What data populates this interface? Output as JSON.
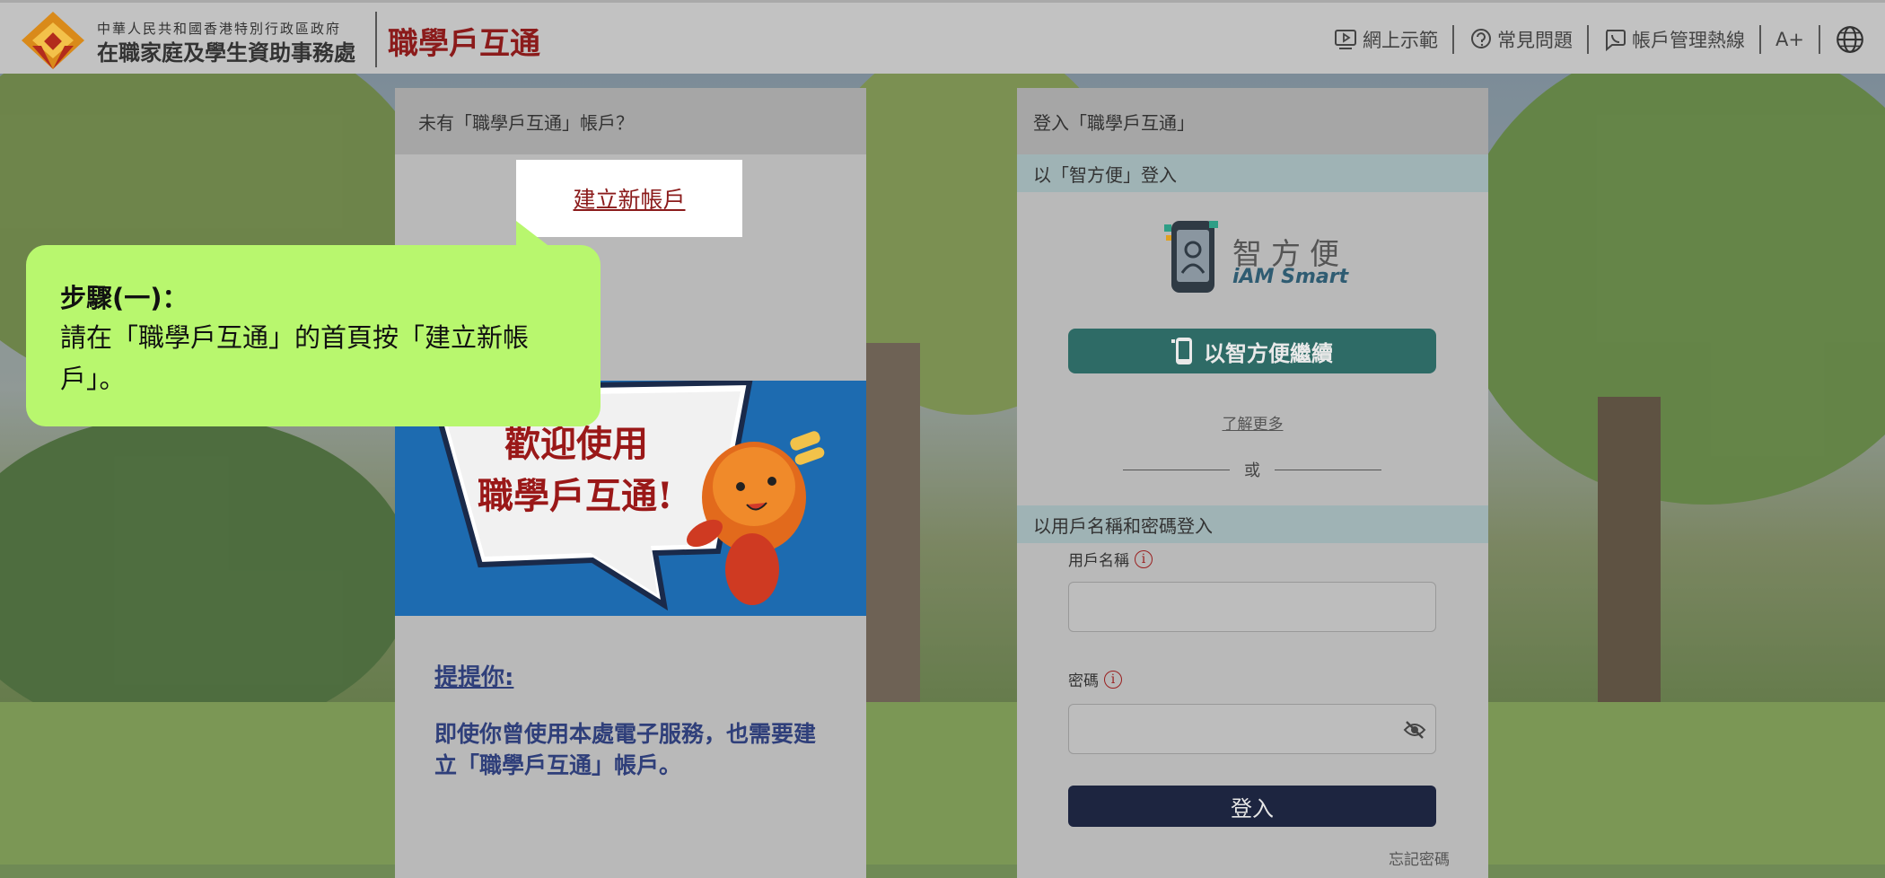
{
  "header": {
    "gov_line1": "中華人民共和國香港特別行政區政府",
    "gov_line2": "在職家庭及學生資助事務處",
    "brand": "職學戶互通",
    "nav": [
      {
        "label": "網上示範",
        "icon": "play-screen-icon"
      },
      {
        "label": "常見問題",
        "icon": "question-bubble-icon"
      },
      {
        "label": "帳戶管理熱線",
        "icon": "phone-bubble-icon"
      }
    ],
    "font_size_label": "A+",
    "language_icon": "globe-icon"
  },
  "left_card": {
    "title": "未有「職學戶互通」帳戶？",
    "create_account": "建立新帳戶",
    "banner_line1": "歡迎使用",
    "banner_line2": "職學戶互通!",
    "remind_title": "提提你:",
    "remind_body": "即使你曾使用本處電子服務，也需要建立「職學戶互通」帳戶。"
  },
  "callout": {
    "title": "步驟(一)：",
    "body": "請在「職學戶互通」的首頁按「建立新帳戶」。"
  },
  "right_card": {
    "title": "登入「職學戶互通」",
    "iam_section": "以「智方便」登入",
    "iam_zh": "智方便",
    "iam_en": "iAM Smart",
    "iam_button": "以智方便繼續",
    "learn_more": "了解更多",
    "or": "或",
    "pw_section": "以用戶名稱和密碼登入",
    "username_label": "用戶名稱",
    "username_value": "",
    "password_label": "密碼",
    "password_value": "",
    "login_button": "登入",
    "forgot": "忘記密碼"
  },
  "colors": {
    "brand_red": "#8b1b1b",
    "callout_green": "#b8f76e",
    "iam_teal": "#2e6b66",
    "login_navy": "#1d2540"
  }
}
